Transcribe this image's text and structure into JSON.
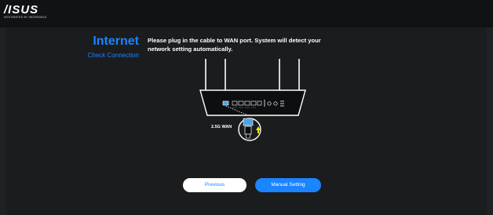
{
  "brand": {
    "name": "/ISUS",
    "tagline": "INTEGRATED BY INCREDIBLE"
  },
  "step": {
    "title": "Internet",
    "subtitle": "Check Connection"
  },
  "instruction": "Please plug in the cable to WAN port. System will detect your network setting automatically.",
  "illustration": {
    "port_label": "2.5G WAN",
    "icons": [
      "router-icon",
      "ethernet-plug-icon",
      "arrow-up-icon"
    ]
  },
  "actions": {
    "previous": "Previous",
    "manual": "Manual Setting"
  },
  "colors": {
    "background": "#202124",
    "accent": "#1b84ff",
    "plug": "#4fa3e0",
    "arrow": "#f5e600"
  }
}
